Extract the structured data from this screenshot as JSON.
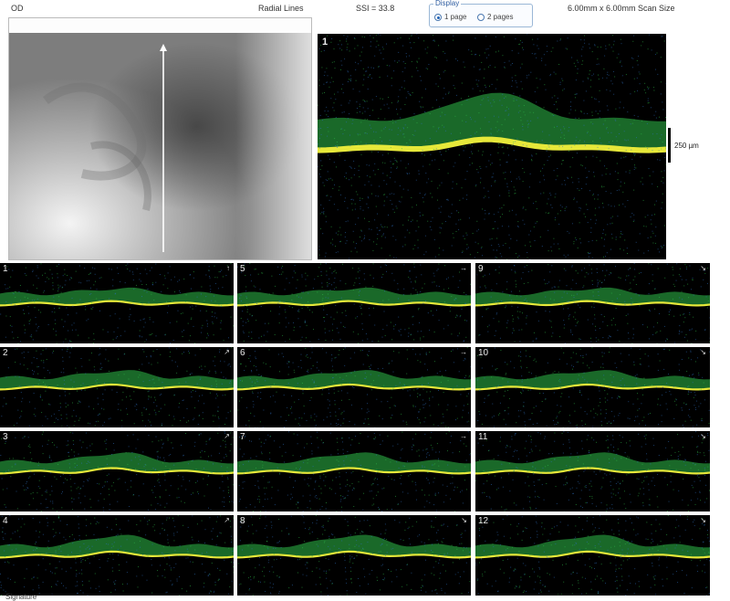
{
  "header": {
    "eye": "OD",
    "protocol": "Radial Lines",
    "ssi": "SSI = 33.8",
    "scan_size": "6.00mm x 6.00mm Scan Size",
    "display": {
      "legend": "Display",
      "options": [
        {
          "label": "1 page",
          "selected": true
        },
        {
          "label": "2 pages",
          "selected": false
        }
      ]
    }
  },
  "main_scan": {
    "number": "1"
  },
  "scale_label": "250 µm",
  "thumbnails": [
    {
      "number": "1"
    },
    {
      "number": "2"
    },
    {
      "number": "3"
    },
    {
      "number": "4"
    },
    {
      "number": "5"
    },
    {
      "number": "6"
    },
    {
      "number": "7"
    },
    {
      "number": "8"
    },
    {
      "number": "9"
    },
    {
      "number": "10"
    },
    {
      "number": "11"
    },
    {
      "number": "12"
    }
  ],
  "footer": {
    "text": "Signature"
  },
  "colors": {
    "background": "#ffffff",
    "scan_background": "#000000",
    "retina_green": "#2fbf4a",
    "rpe_yellow": "#e6e83a",
    "noise_blue": "#2d6fbf",
    "radio_accent": "#1d5fb4"
  }
}
